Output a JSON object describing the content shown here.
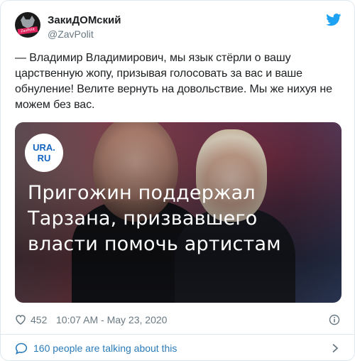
{
  "author": {
    "display_name": "ЗакиДОМский",
    "handle": "@ZavPolit",
    "avatar_tag": "ZavPolit"
  },
  "tweet": {
    "text": "— Владимир Владимирович, мы язык стёрли о вашу царственную жопу, призывая голосовать за вас и ваше обнуление! Велите вернуть на довольствие. Мы же нихуя не можем без вас."
  },
  "media": {
    "logo_text_line1": "URA.",
    "logo_text_line2": "RU",
    "headline": "Пригожин поддержал Тарзана, призвавшего власти помочь артистам"
  },
  "meta": {
    "likes": "452",
    "timestamp": "10:07 AM - May 23, 2020"
  },
  "footer": {
    "talking": "160 people are talking about this"
  },
  "colors": {
    "twitter_blue": "#1da1f2",
    "link_blue": "#2b7bb9",
    "muted": "#697882",
    "logo_blue": "#1565c0"
  },
  "icons": [
    "twitter-bird-icon",
    "heart-icon",
    "info-icon",
    "speech-bubble-icon",
    "chevron-right-icon"
  ]
}
